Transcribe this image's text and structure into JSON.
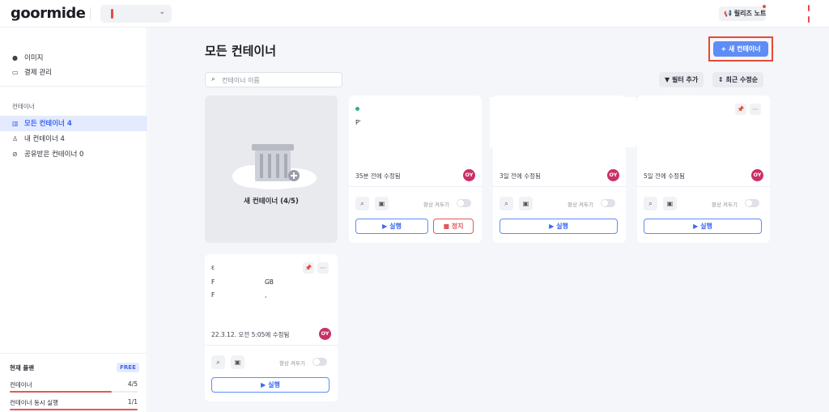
{
  "app": {
    "logo": "goormide"
  },
  "topbar": {
    "release_notes": "릴리즈 노트",
    "workspace_chevron": "⌄"
  },
  "sidebar": {
    "top_items": [
      {
        "label": "이미지",
        "icon": "image-icon"
      },
      {
        "label": "결제 관리",
        "icon": "card-icon"
      }
    ],
    "section_title": "컨테이너",
    "container_items": [
      {
        "label": "모든 컨테이너  4",
        "icon": "grid-icon",
        "active": true
      },
      {
        "label": "내 컨테이너  4",
        "icon": "user-icon",
        "active": false
      },
      {
        "label": "공유받은 컨테이너  0",
        "icon": "link-icon",
        "active": false
      }
    ],
    "plan": {
      "title": "현재 플랜",
      "badge": "FREE",
      "usage": [
        {
          "label": "컨테이너",
          "value": "4/5",
          "fraction": 0.8
        },
        {
          "label": "컨테이너 동시 실행",
          "value": "1/1",
          "fraction": 1.0
        }
      ]
    }
  },
  "main": {
    "title": "모든 컨테이너",
    "new_button": "+ 새 컨테이너",
    "search_placeholder": "컨테이너 이름",
    "filter_button": "필터 추가",
    "sort_button": "최근 수정순",
    "new_card_label": "새 컨테이너 (4/5)",
    "cards": [
      {
        "name_fragment": "P'",
        "modified": "35분 전에 수정됨",
        "avatar": "OY",
        "always_on": "항상 켜두기",
        "run": "▶ 실행",
        "stop": "■ 정지",
        "running": true
      },
      {
        "modified": "3일 전에 수정됨",
        "avatar": "OY",
        "always_on": "항상 켜두기",
        "run": "▶ 실행",
        "running": false
      },
      {
        "modified": "5일 전에 수정됨",
        "avatar": "OY",
        "always_on": "항상 켜두기",
        "run": "▶ 실행",
        "running": false
      },
      {
        "name_fragment": "ε",
        "meta1_a": "F",
        "meta1_b": "GB",
        "meta2_a": "F",
        "meta2_b": ",",
        "modified": "22.3.12. 오전 5:05에 수정됨",
        "avatar": "OY",
        "always_on": "항상 켜두기",
        "run": "▶ 실행",
        "running": false
      }
    ]
  },
  "colors": {
    "accent": "#5f8df7",
    "stop": "#e25858",
    "avatar": "#c93068",
    "active_bg": "#e4ebff",
    "highlight_box": "#e5483a"
  }
}
